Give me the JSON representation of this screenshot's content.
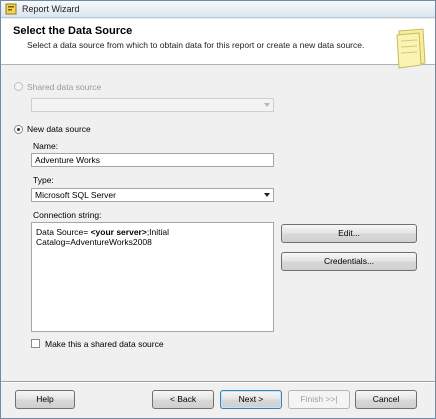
{
  "window": {
    "title": "Report Wizard"
  },
  "header": {
    "title": "Select the Data Source",
    "description": "Select a data source from which to obtain data for this report or create a new data source."
  },
  "shared": {
    "label": "Shared data source",
    "selected": false,
    "value": ""
  },
  "new_source": {
    "label": "New data source",
    "selected": true,
    "name_label": "Name:",
    "name_value": "Adventure Works",
    "type_label": "Type:",
    "type_value": "Microsoft SQL Server",
    "conn_label": "Connection string:",
    "conn_prefix": "Data Source= ",
    "conn_server": "<your server>",
    "conn_suffix": ";Initial Catalog=AdventureWorks2008"
  },
  "buttons": {
    "edit": "Edit...",
    "credentials": "Credentials...",
    "help": "Help",
    "back": "< Back",
    "next": "Next >",
    "finish": "Finish >>|",
    "cancel": "Cancel"
  },
  "shared_checkbox": {
    "label": "Make this a shared data source",
    "checked": false
  },
  "colors": {
    "accent": "#3c7fb1",
    "header_bg": "#ffffff",
    "body_bg": "#f0f0f0"
  }
}
